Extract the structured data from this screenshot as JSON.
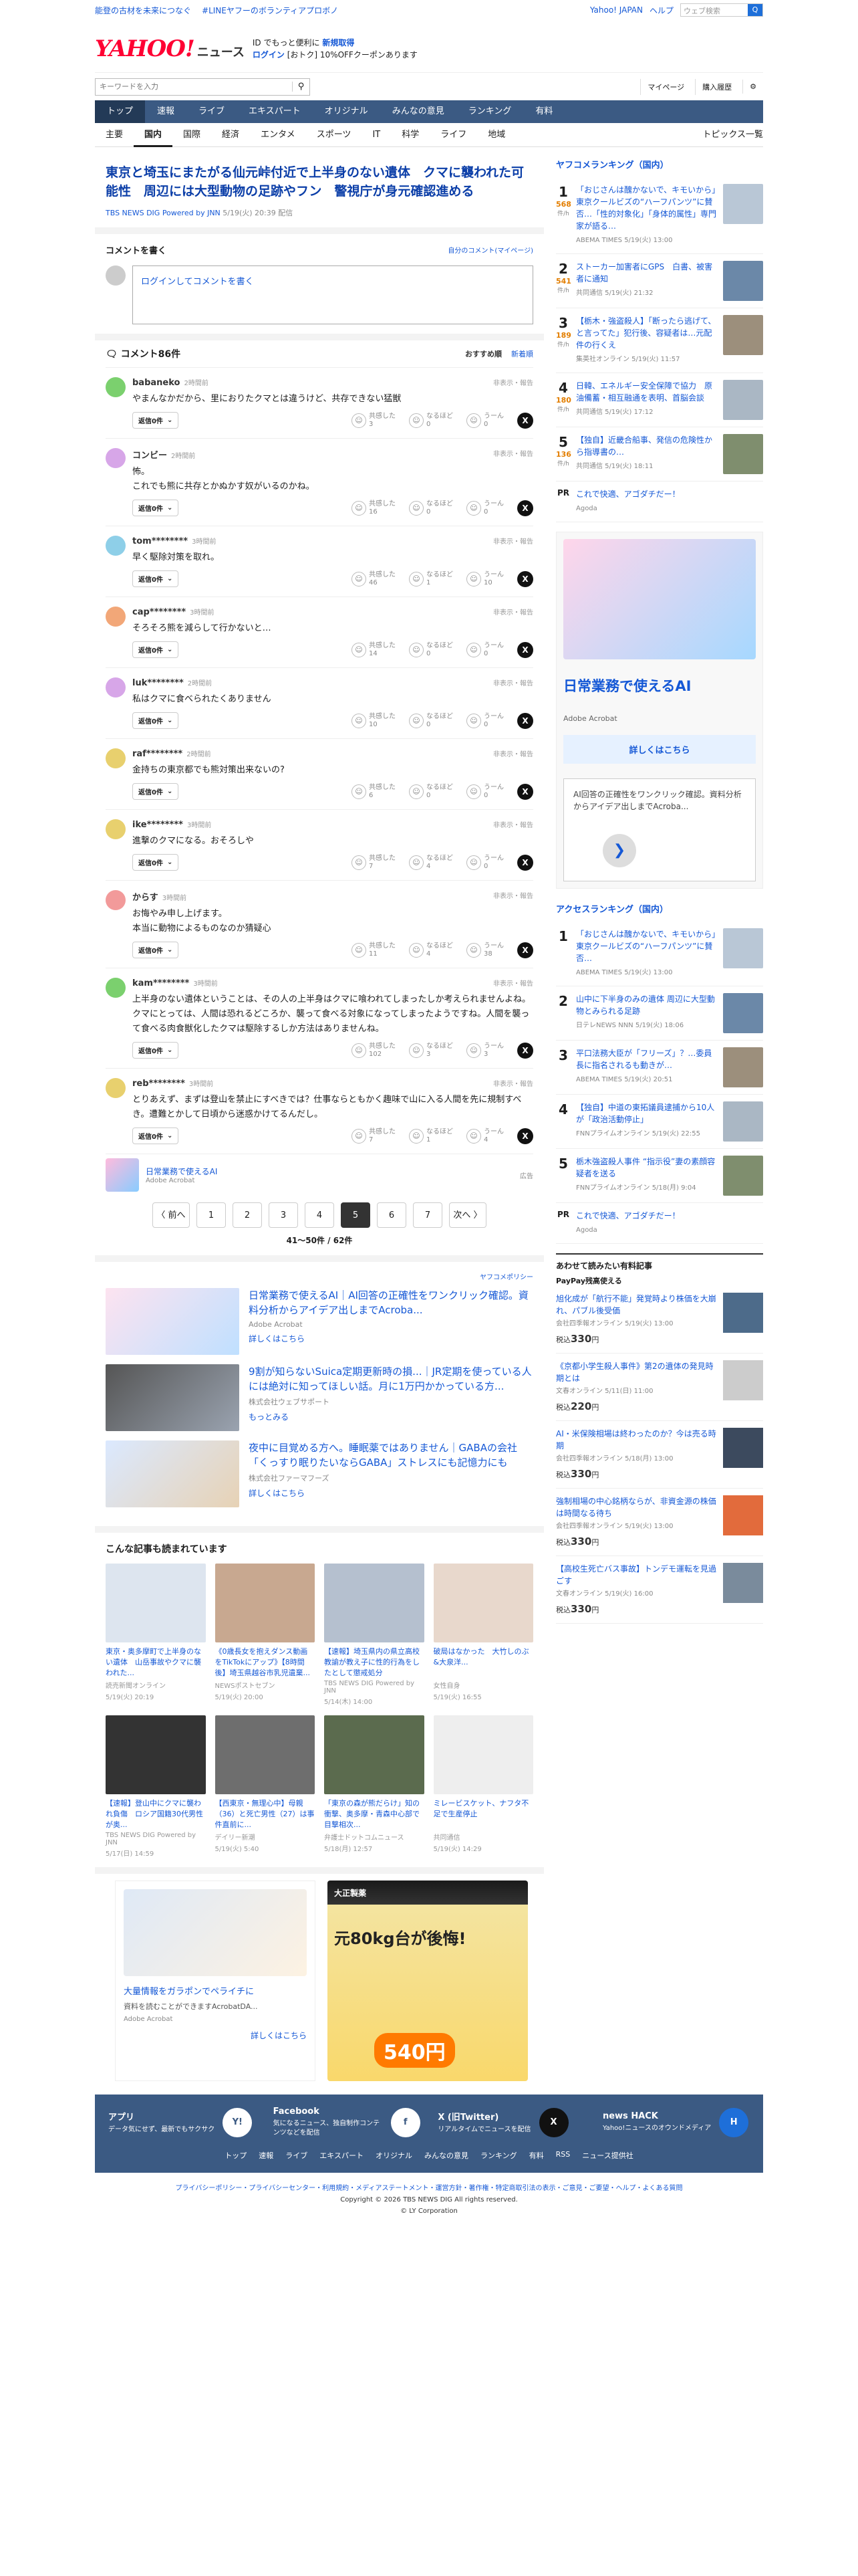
{
  "topbar": {
    "links": [
      "能登の古材を未来につなぐ",
      "#LINEヤフーのボランティアプロボノ"
    ],
    "right_links": [
      "Yahoo! JAPAN",
      "ヘルプ"
    ],
    "mini_search_placeholder": "ウェブ検索",
    "mini_search_btn": "Q"
  },
  "header": {
    "logo": "YAHOO!",
    "logo_sub": "JAPAN",
    "brand": "ニュース",
    "promo1": "ID でもっと便利に",
    "promo1b": "新規取得",
    "promo2": "ログイン",
    "promo3": "[おトク] 10%OFFクーポンあります"
  },
  "search": {
    "placeholder": "キーワードを入力",
    "links": [
      "マイページ",
      "購入履歴"
    ]
  },
  "gnav": [
    "トップ",
    "速報",
    "ライブ",
    "エキスパート",
    "オリジナル",
    "みんなの意見",
    "ランキング",
    "有料"
  ],
  "snav": [
    "主要",
    "国内",
    "国際",
    "経済",
    "エンタメ",
    "スポーツ",
    "IT",
    "科学",
    "ライフ",
    "地域"
  ],
  "snav_right": "トピックス一覧",
  "article": {
    "title": "東京と埼玉にまたがる仙元峠付近で上半身のない遺体　クマに襲われた可能性　周辺には大型動物の足跡やフン　警視庁が身元確認進める",
    "source": "TBS NEWS DIG Powered by JNN",
    "date": "5/19(火) 20:39 配信"
  },
  "write": {
    "title": "コメントを書く",
    "own": "自分のコメント(マイページ)",
    "prompt": "ログインしてコメントを書く"
  },
  "comments_head": {
    "title": "コメント86件",
    "sort1": "おすすめ順",
    "sort2": "新着順"
  },
  "comment_labels": {
    "hide": "非表示・報告",
    "reply": "返信0件",
    "r1": "共感した",
    "r2": "なるほど",
    "r3": "うーん"
  },
  "comments": [
    {
      "name": "babaneko",
      "time": "2時間前",
      "text": "やまんなかだから、里におりたクマとは違うけど、共存できない猛獣",
      "c1": "3",
      "c2": "0",
      "c3": "0",
      "color": "#7bd06e"
    },
    {
      "name": "コンビー",
      "time": "2時間前",
      "text": "怖。\nこれでも熊に共存とかぬかす奴がいるのかね。",
      "c1": "16",
      "c2": "0",
      "c3": "0",
      "color": "#d7a6e8"
    },
    {
      "name": "tom********",
      "time": "3時間前",
      "text": "早く駆除対策を取れ。",
      "c1": "46",
      "c2": "1",
      "c3": "10",
      "color": "#8ecfe8"
    },
    {
      "name": "cap********",
      "time": "3時間前",
      "text": "そろそろ熊を減らして行かないと…",
      "c1": "14",
      "c2": "0",
      "c3": "0",
      "color": "#f2a778"
    },
    {
      "name": "luk********",
      "time": "2時間前",
      "text": "私はクマに食べられたくありません",
      "c1": "10",
      "c2": "0",
      "c3": "0",
      "color": "#d7a6e8"
    },
    {
      "name": "raf********",
      "time": "2時間前",
      "text": "金持ちの東京都でも熊対策出来ないの?",
      "c1": "6",
      "c2": "0",
      "c3": "0",
      "color": "#e8d06e"
    },
    {
      "name": "ike********",
      "time": "3時間前",
      "text": "進撃のクマになる。おそろしや",
      "c1": "7",
      "c2": "4",
      "c3": "0",
      "color": "#e8d06e"
    },
    {
      "name": "からす",
      "time": "3時間前",
      "text": "お悔やみ申し上げます。\n本当に動物によるものなのか猜疑心",
      "c1": "11",
      "c2": "4",
      "c3": "38",
      "color": "#f29a9a"
    },
    {
      "name": "kam********",
      "time": "3時間前",
      "text": "上半身のない遺体ということは、その人の上半身はクマに喰われてしまったしか考えられませんよね。\nクマにとっては、人間は恐れるどころか、襲って食べる対象になってしまったようですね。人間を襲って食べる肉食獣化したクマは駆除するしか方法はありませんね。",
      "c1": "102",
      "c2": "3",
      "c3": "3",
      "color": "#7bd06e"
    },
    {
      "name": "reb********",
      "time": "3時間前",
      "text": "とりあえず、まずは登山を禁止にすべきでは？仕事ならともかく趣味で山に入る人間を先に規制すべき。遭難とかして日頃から迷惑かけてるんだし。",
      "c1": "7",
      "c2": "1",
      "c3": "4",
      "color": "#e8d06e"
    }
  ],
  "inline_ad": {
    "title": "日常業務で使えるAI",
    "adv": "Adobe Acrobat",
    "label": "広告"
  },
  "pager": {
    "prev": "〈 前へ",
    "pages": [
      "1",
      "2",
      "3",
      "4",
      "5",
      "6",
      "7"
    ],
    "next": "次へ 〉",
    "info": "41〜50件 / 62件"
  },
  "policy": "ヤフコメポリシー",
  "promos": [
    {
      "title": "日常業務で使えるAI｜AI回答の正確性をワンクリック確認。資料分析からアイデア出しまでAcroba...",
      "sponsor": "Adobe Acrobat",
      "more": "詳しくはこちら"
    },
    {
      "title": "9割が知らないSuica定期更新時の損...｜JR定期を使っている人には絶対に知ってほしい話。月に1万円かかっている方...",
      "sponsor": "株式会社ウェブサポート",
      "more": "もっとみる"
    },
    {
      "title": "夜中に目覚める方へ。睡眠薬ではありません｜GABAの会社「くっすり眠りたいならGABA」ストレスにも記憶力にも",
      "sponsor": "株式会社ファーマフーズ",
      "more": "詳しくはこちら"
    }
  ],
  "read_title": "こんな記事も読まれています",
  "reads": [
    {
      "t": "東京・奥多摩町で上半身のない遺体　山岳事故やクマに襲われた...",
      "s": "読売新聞オンライン",
      "d": "5/19(火) 20:19"
    },
    {
      "t": "《0歳長女を抱えダンス動画をTikTokにアップ》【8時間後】埼玉県越谷市乳児遺棄...",
      "s": "NEWSポストセブン",
      "d": "5/19(火) 20:00"
    },
    {
      "t": "【速報】埼玉県内の県立高校教諭が教え子に性的行為をしたとして懲戒処分",
      "s": "TBS NEWS DIG Powered by JNN",
      "d": "5/14(木) 14:00"
    },
    {
      "t": "破局はなかった　大竹しのぶ&大泉洋...",
      "s": "女性自身",
      "d": "5/19(火) 16:55"
    },
    {
      "t": "【速報】登山中にクマに襲われ負傷　ロシア国籍30代男性が奥...",
      "s": "TBS NEWS DIG Powered by JNN",
      "d": "5/17(日) 14:59"
    },
    {
      "t": "【西東京・無理心中】母親（36）と死亡男性（27）は事件直前に...",
      "s": "デイリー新潮",
      "d": "5/19(火) 5:40"
    },
    {
      "t": "「東京の森が熊だらけ」知の衝撃、奥多摩・青森中心部で目撃相次...",
      "s": "弁護士ドットコムニュース",
      "d": "5/18(月) 12:57"
    },
    {
      "t": "ミレービスケット、ナフタ不足で生産停止",
      "s": "共同通信",
      "d": "5/19(火) 14:29"
    }
  ],
  "side_rank1": {
    "title": "ヤフコメランキング（国内）",
    "items": [
      {
        "n": "1",
        "c": "568",
        "t": "「おじさんは醜かないで、キモいから」東京クールビズの“ハーフパンツ”に賛否…「性的対象化」「身体的属性」専門家が語る…",
        "s": "ABEMA TIMES 5/19(火) 13:00"
      },
      {
        "n": "2",
        "c": "541",
        "t": "ストーカー加害者にGPS　白書、被害者に通知",
        "s": "共同通信 5/19(火) 21:32"
      },
      {
        "n": "3",
        "c": "189",
        "t": "【栃木・強盗殺人】「断ったら逃げて、と言ってた」犯行後、容疑者は…元配件の行くえ",
        "s": "集英社オンライン 5/19(火) 11:57"
      },
      {
        "n": "4",
        "c": "180",
        "t": "日韓、エネルギー安全保障で協力　原油備蓄・相互融通を表明、首脳会談",
        "s": "共同通信 5/19(火) 17:12"
      },
      {
        "n": "5",
        "c": "136",
        "t": "【独自】近畿合船事、発信の危険性から指導書の…",
        "s": "共同通信 5/19(火) 18:11"
      }
    ],
    "pr": "これで快適、アゴダチだー！",
    "pr_src": "Agoda"
  },
  "side_ad": {
    "title": "日常業務で使えるAI",
    "adv": "Adobe Acrobat",
    "cta": "詳しくはこちら",
    "desc": "AI回答の正確性をワンクリック確認。資料分析からアイデア出しまでAcroba..."
  },
  "side_rank2": {
    "title": "アクセスランキング（国内）",
    "items": [
      {
        "n": "1",
        "t": "「おじさんは醜かないで、キモいから」東京クールビズの“ハーフパンツ”に賛否…",
        "s": "ABEMA TIMES 5/19(火) 13:00"
      },
      {
        "n": "2",
        "t": "山中に下半身のみの遺体 周辺に大型動物とみられる足跡",
        "s": "日テレNEWS NNN 5/19(火) 18:06"
      },
      {
        "n": "3",
        "t": "平口法務大臣が「フリーズ」？…委員長に指名されるも動きが…",
        "s": "ABEMA TIMES 5/19(火) 20:51"
      },
      {
        "n": "4",
        "t": "【独自】中道の東拓議員逮捕から10人が「政治活動停止」",
        "s": "FNNプライムオンライン 5/19(火) 22:55"
      },
      {
        "n": "5",
        "t": "栃木強盗殺人事件 “指示役”妻の素顔容疑者を送る",
        "s": "FNNプライムオンライン 5/18(月) 9:04"
      }
    ],
    "pr": "これで快適、アゴダチだー！",
    "pr_src": "Agoda"
  },
  "side_shop": {
    "title": "あわせて読みたい有料記事",
    "brand": "PayPay残高使える",
    "items": [
      {
        "t": "旭化成が「航行不能」発覚時より株価を大崩れ、パブル後受価",
        "s": "会社四季報オンライン 5/19(火) 13:00",
        "p": "330"
      },
      {
        "t": "《京都小学生殺人事件》第2の遺体の発見時期とは",
        "s": "文春オンライン 5/11(日) 11:00",
        "p": "220"
      },
      {
        "t": "AI・米保険相場は終わったのか？今は売る時期",
        "s": "会社四季報オンライン 5/18(月) 13:00",
        "p": "330"
      },
      {
        "t": "強制相場の中心銘柄ならが、非資金源の株価は時間なる待ち",
        "s": "会社四季報オンライン 5/19(火) 13:00",
        "p": "330"
      },
      {
        "t": "【高校生死亡バス事故】トンデモ運転を見過ごす",
        "s": "文春オンライン 5/19(火) 16:00",
        "p": "330"
      }
    ],
    "unit": "税込"
  },
  "bottom_ads": {
    "left_title": "大量情報をガラポンでペライチに",
    "left_desc": "資料を読むことができますAcrobatDA...",
    "left_adv": "Adobe Acrobat",
    "left_cta": "詳しくはこちら",
    "right_brand": "大正製薬",
    "right_headline": "元80kg台が後悔!",
    "right_price": "540円"
  },
  "footer": {
    "cols": [
      {
        "t": "アプリ",
        "d": "データ気にせず、最新でもサクサク"
      },
      {
        "t": "Facebook",
        "d": "気になるニュース、独自制作コンテンツなどを配信"
      },
      {
        "t": "X (旧Twitter)",
        "d": "リアルタイムでニュースを配信"
      },
      {
        "t": "news HACK",
        "d": "Yahoo!ニュースのオウンドメディア"
      }
    ],
    "links": [
      "トップ",
      "速報",
      "ライブ",
      "エキスパート",
      "オリジナル",
      "みんなの意見",
      "ランキング",
      "有料",
      "RSS",
      "ニュース提供社"
    ],
    "legal": "プライバシーポリシー・プライバシーセンター・利用規約・メディアステートメント・運営方針・著作権・特定商取引法の表示・ご意見・ご要望・ヘルプ・よくある質問",
    "copy1": "Copyright © 2026 TBS NEWS DIG All rights reserved.",
    "copy2": "© LY Corporation"
  }
}
